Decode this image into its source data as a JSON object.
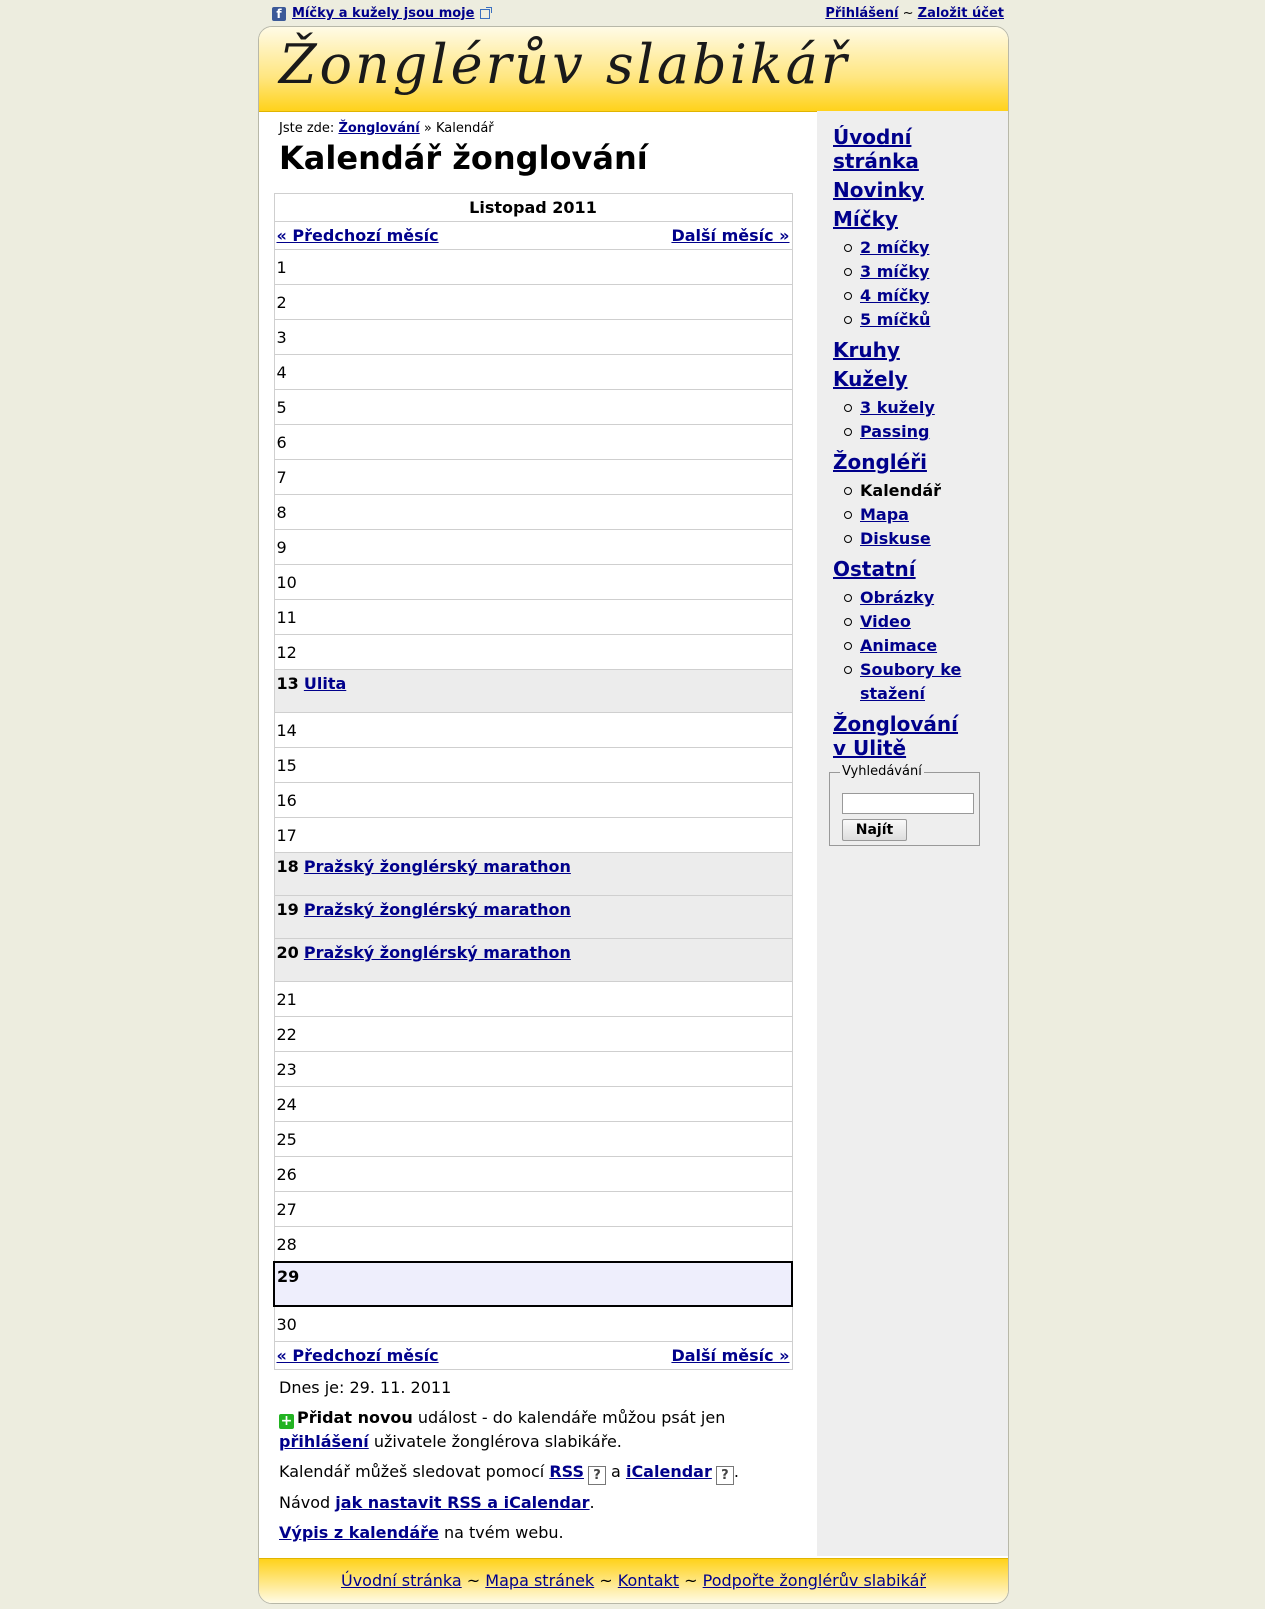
{
  "topbar": {
    "fb_link": "Míčky a kužely jsou moje",
    "login": "Přihlášení",
    "sep": "~",
    "register": "Založit účet"
  },
  "header": {
    "logo": "Žonglérův slabikář"
  },
  "breadcrumb": {
    "prefix": "Jste zde:",
    "link": "Žonglování",
    "sep": "»",
    "current": "Kalendář"
  },
  "page_title": "Kalendář žonglování",
  "calendar": {
    "month": "Listopad 2011",
    "prev": "« Předchozí měsíc",
    "next": "Další měsíc »",
    "days": [
      {
        "n": "1"
      },
      {
        "n": "2"
      },
      {
        "n": "3"
      },
      {
        "n": "4"
      },
      {
        "n": "5"
      },
      {
        "n": "6"
      },
      {
        "n": "7"
      },
      {
        "n": "8"
      },
      {
        "n": "9"
      },
      {
        "n": "10"
      },
      {
        "n": "11"
      },
      {
        "n": "12"
      },
      {
        "n": "13",
        "event": "Ulita"
      },
      {
        "n": "14"
      },
      {
        "n": "15"
      },
      {
        "n": "16"
      },
      {
        "n": "17"
      },
      {
        "n": "18",
        "event": "Pražský žonglérský marathon"
      },
      {
        "n": "19",
        "event": "Pražský žonglérský marathon"
      },
      {
        "n": "20",
        "event": "Pražský žonglérský marathon"
      },
      {
        "n": "21"
      },
      {
        "n": "22"
      },
      {
        "n": "23"
      },
      {
        "n": "24"
      },
      {
        "n": "25"
      },
      {
        "n": "26"
      },
      {
        "n": "27"
      },
      {
        "n": "28"
      },
      {
        "n": "29",
        "today": true
      },
      {
        "n": "30"
      }
    ]
  },
  "info": {
    "today": "Dnes je: 29. 11. 2011",
    "add_bold": "Přidat novou",
    "add_rest": " událost - do kalendáře můžou psát jen",
    "add_link": "přihlášení",
    "add_tail": " uživatele žonglérova slabikáře.",
    "follow_prefix": "Kalendář můžeš sledovat pomocí ",
    "rss": "RSS",
    "follow_and": " a ",
    "ical": "iCalendar",
    "q": "?",
    "dot": ".",
    "howto_prefix": "Návod ",
    "howto_link": "jak nastavit RSS a iCalendar",
    "export_link": "Výpis z kalendáře",
    "export_rest": " na tvém webu."
  },
  "sidebar": {
    "home": "Úvodní stránka",
    "news": "Novinky",
    "balls": "Míčky",
    "balls_items": [
      "2 míčky",
      "3 míčky",
      "4 míčky",
      "5 míčků"
    ],
    "rings": "Kruhy",
    "clubs": "Kužely",
    "clubs_items": [
      "3 kužely",
      "Passing"
    ],
    "jugglers": "Žongléři",
    "jugglers_current": "Kalendář",
    "jugglers_items": [
      "Mapa",
      "Diskuse"
    ],
    "other": "Ostatní",
    "other_items": [
      "Obrázky",
      "Video",
      "Animace",
      "Soubory ke stažení"
    ],
    "ulita": "Žonglování v Ulitě",
    "search_legend": "Vyhledávání",
    "search_button": "Najít"
  },
  "footer": {
    "links": [
      "Úvodní stránka",
      "Mapa stránek",
      "Kontakt",
      "Podpořte žonglérův slabikář"
    ],
    "sep": "~"
  }
}
